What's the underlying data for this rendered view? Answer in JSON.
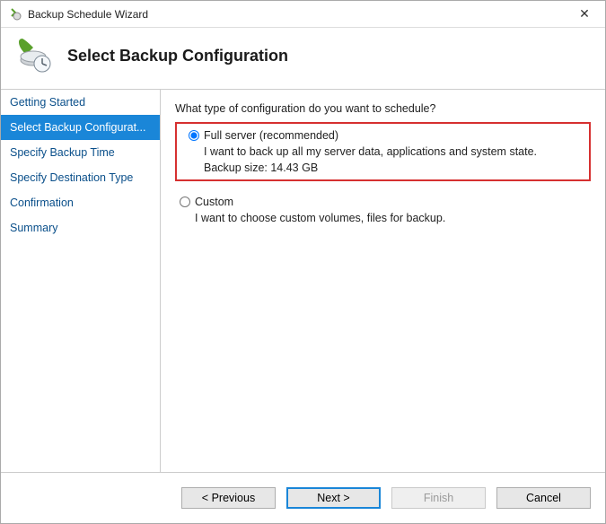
{
  "window": {
    "title": "Backup Schedule Wizard"
  },
  "header": {
    "title": "Select Backup Configuration"
  },
  "sidebar": {
    "items": [
      {
        "label": "Getting Started",
        "active": false
      },
      {
        "label": "Select Backup Configurat...",
        "active": true
      },
      {
        "label": "Specify Backup Time",
        "active": false
      },
      {
        "label": "Specify Destination Type",
        "active": false
      },
      {
        "label": "Confirmation",
        "active": false
      },
      {
        "label": "Summary",
        "active": false
      }
    ]
  },
  "content": {
    "prompt": "What type of configuration do you want to schedule?",
    "options": [
      {
        "id": "full",
        "label": "Full server (recommended)",
        "desc": "I want to back up all my server data, applications and system state.",
        "size": "Backup size: 14.43 GB",
        "selected": true,
        "highlighted": true
      },
      {
        "id": "custom",
        "label": "Custom",
        "desc": "I want to choose custom volumes, files for backup.",
        "selected": false,
        "highlighted": false
      }
    ]
  },
  "footer": {
    "previous": "< Previous",
    "next": "Next >",
    "finish": "Finish",
    "cancel": "Cancel"
  }
}
